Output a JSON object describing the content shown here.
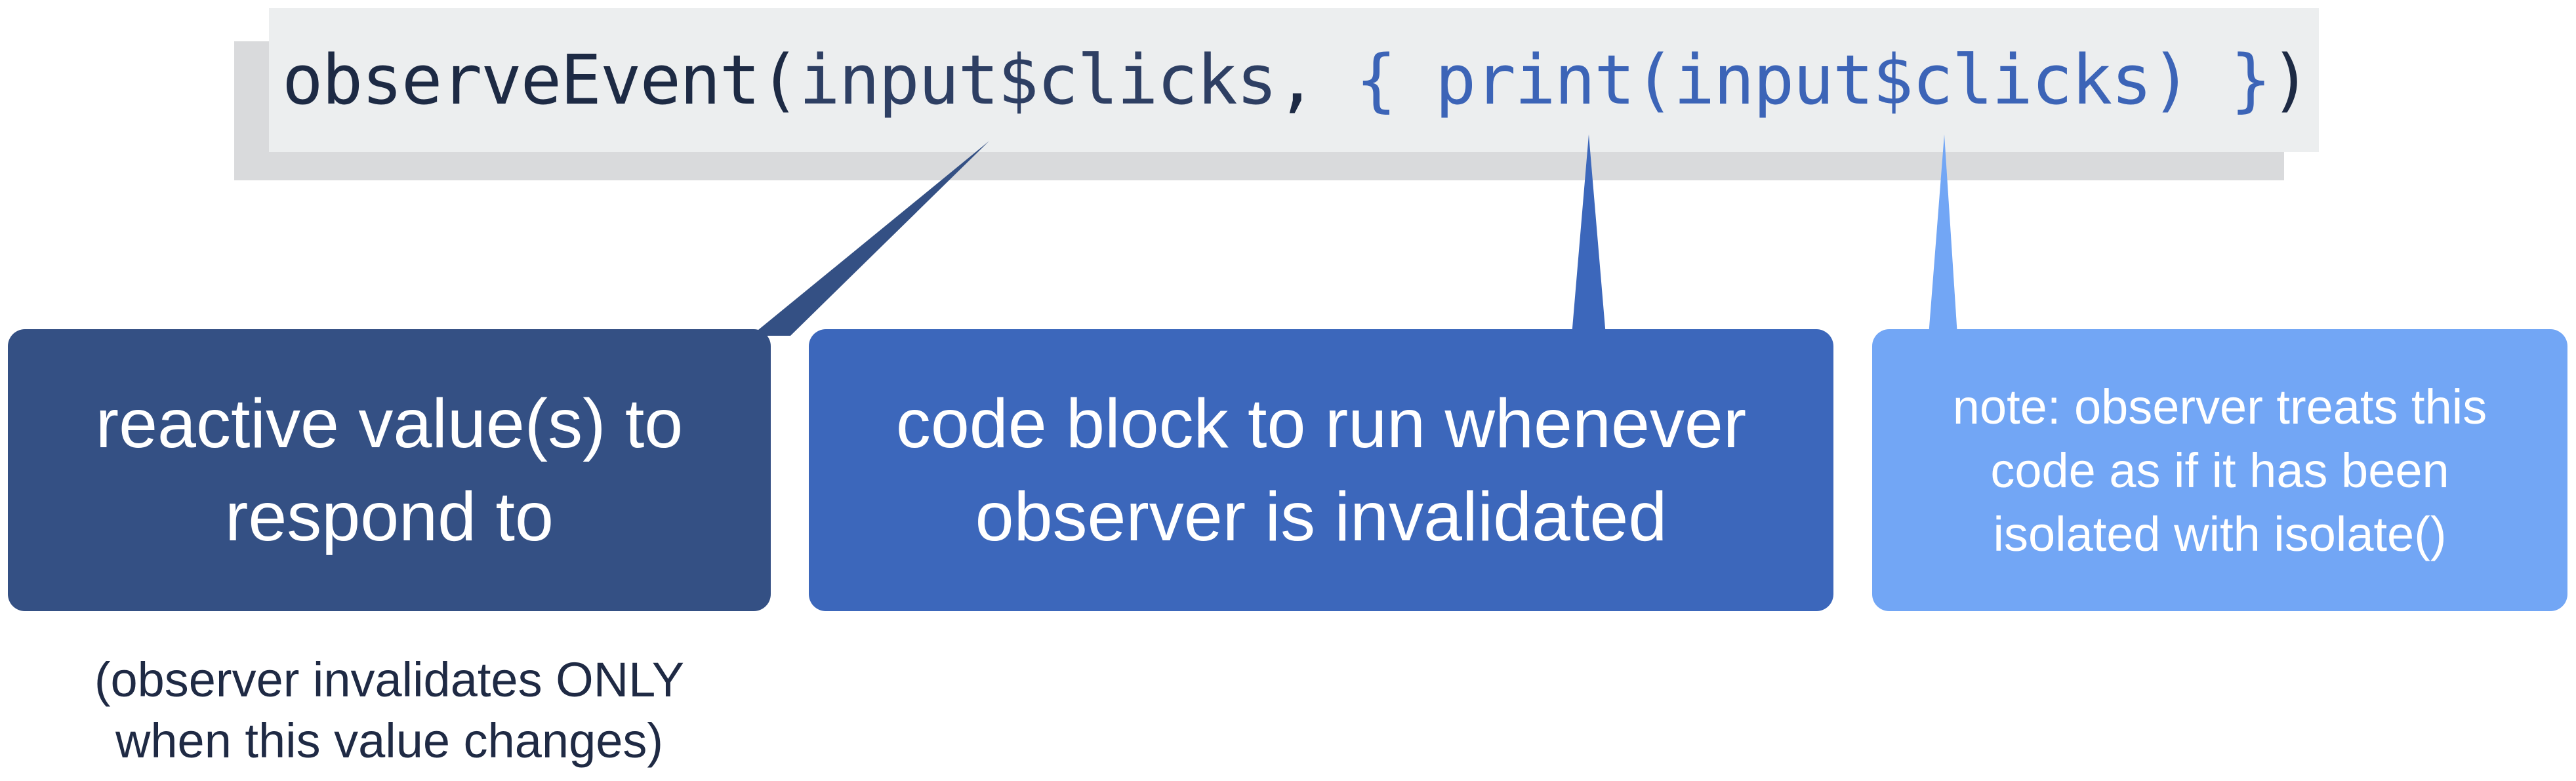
{
  "code": {
    "fn": "observeEvent(",
    "arg": "input$clicks",
    "sep": ", ",
    "body": "{ print(input$clicks) }",
    "close": ")"
  },
  "callouts": [
    {
      "lines": [
        "reactive value(s) to",
        "respond to"
      ],
      "color": "#345084"
    },
    {
      "lines": [
        "code block to run whenever",
        "observer is invalidated"
      ],
      "color": "#3c67bb"
    },
    {
      "lines": [
        "note: observer treats this",
        "code as if it has been",
        "isolated with isolate()"
      ],
      "color": "#72a6f5"
    }
  ],
  "footnote": {
    "lines": [
      "(observer invalidates ONLY",
      "when this value changes)"
    ]
  }
}
